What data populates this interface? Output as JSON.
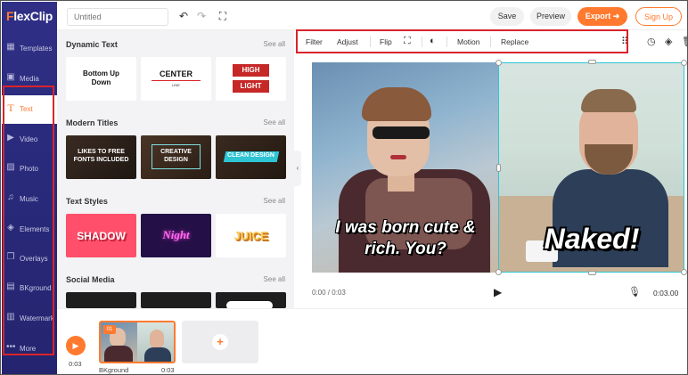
{
  "app": {
    "logo_first": "F",
    "logo_rest": "lexClip"
  },
  "sidebar": {
    "items": [
      {
        "label": "Templates",
        "icon": "templates-icon"
      },
      {
        "label": "Media",
        "icon": "media-icon"
      },
      {
        "label": "Text",
        "icon": "text-icon"
      },
      {
        "label": "Video",
        "icon": "video-icon"
      },
      {
        "label": "Photo",
        "icon": "photo-icon"
      },
      {
        "label": "Music",
        "icon": "music-icon"
      },
      {
        "label": "Elements",
        "icon": "elements-icon"
      },
      {
        "label": "Overlays",
        "icon": "overlays-icon"
      },
      {
        "label": "BKground",
        "icon": "background-icon"
      },
      {
        "label": "Watermark",
        "icon": "watermark-icon"
      },
      {
        "label": "More",
        "icon": "more-icon"
      }
    ]
  },
  "topbar": {
    "title_placeholder": "Untitled",
    "save": "Save",
    "preview": "Preview",
    "export": "Export",
    "signup": "Sign Up"
  },
  "panel": {
    "see_all": "See all",
    "sections": [
      {
        "title": "Dynamic Text"
      },
      {
        "title": "Modern Titles"
      },
      {
        "title": "Text Styles"
      },
      {
        "title": "Social Media"
      }
    ],
    "dynamic": {
      "c1": "Bottom Up",
      "c1b": "Down",
      "c2": "CENTER",
      "c2b": "LINE",
      "c3a": "HIGH",
      "c3b": "LIGHT"
    },
    "modern": {
      "c1a": "LIKES TO FREE",
      "c1b": "FONTS INCLUDED",
      "c2a": "CREATIVE",
      "c2b": "DESIGN",
      "c3": "CLEAN DESIGN"
    },
    "styles": {
      "c1": "SHADOW",
      "c2": "Night",
      "c3": "JUICE"
    }
  },
  "toolbar": {
    "filter": "Filter",
    "adjust": "Adjust",
    "flip": "Flip",
    "motion": "Motion",
    "replace": "Replace"
  },
  "canvas": {
    "caption_left_1": "I was born cute &",
    "caption_left_2": "rich. You?",
    "caption_right": "Naked!"
  },
  "player": {
    "time_current": "0:00 / 0:03",
    "time_total": "0:03.00"
  },
  "timeline": {
    "duration": "0:03",
    "clip_badge": "01",
    "clip_label": "BKground",
    "clip_duration": "0:03"
  },
  "colors": {
    "accent": "#ff7a2f",
    "sidebar": "#2f2f86",
    "highlight_red": "#d9242b",
    "selection": "#2dc6d6"
  }
}
